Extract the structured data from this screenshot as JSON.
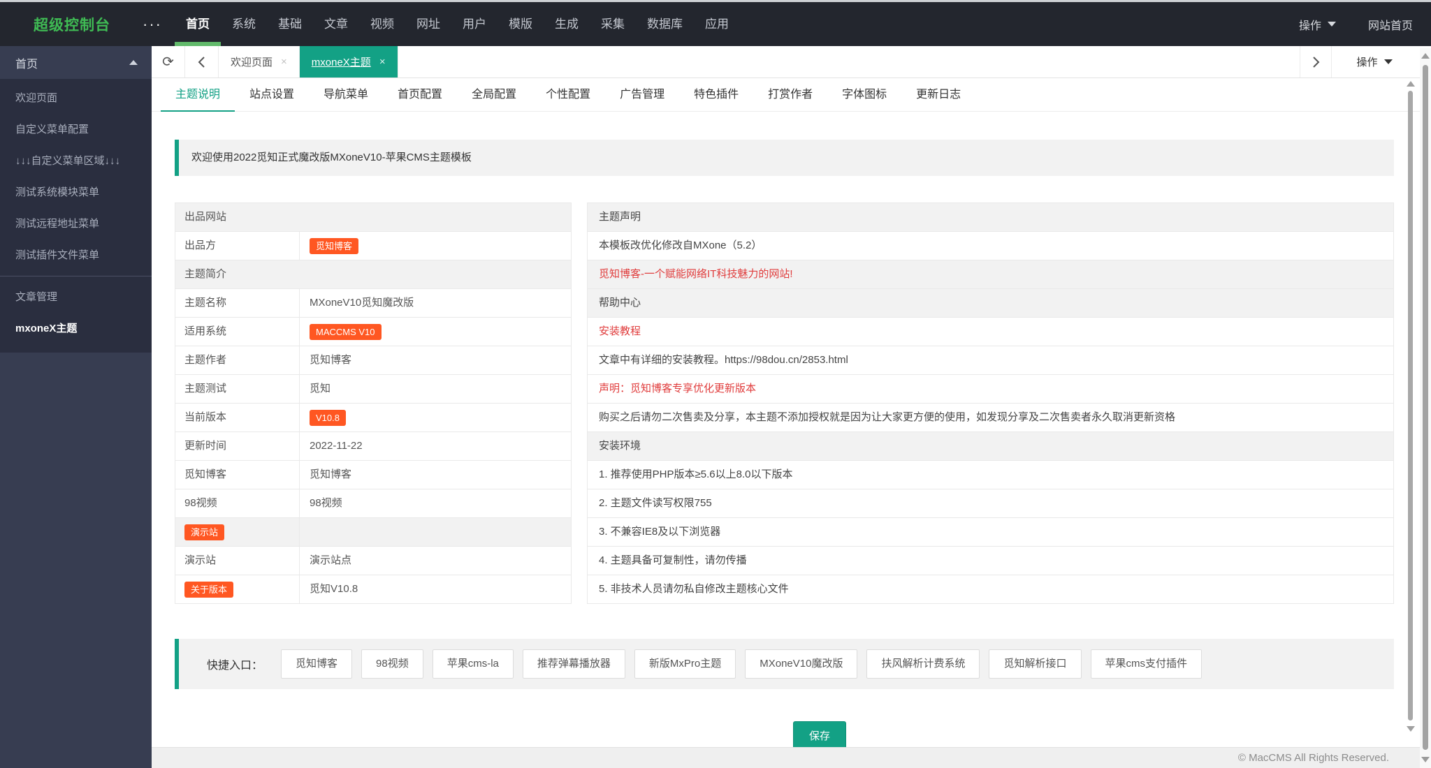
{
  "colors": {
    "accent_teal": "#13a185",
    "brand_green": "#3fbb54",
    "nav_underline_green": "#62ba6b",
    "badge_orange": "#ff5722",
    "red_text": "#e03c3c",
    "topbar_bg": "#23262e",
    "sidebar_bg": "#373d51",
    "sidebar_panel_bg": "#2a2e3f"
  },
  "topbar": {
    "logo": "超级控制台",
    "more_icon": "···",
    "nav": [
      "首页",
      "系统",
      "基础",
      "文章",
      "视频",
      "网址",
      "用户",
      "模版",
      "生成",
      "采集",
      "数据库",
      "应用"
    ],
    "action": "操作",
    "site_home": "网站首页"
  },
  "sidebar": {
    "section": "首页",
    "items": [
      "欢迎页面",
      "自定义菜单配置",
      "↓↓↓自定义菜单区域↓↓↓",
      "测试系统模块菜单",
      "测试远程地址菜单",
      "测试插件文件菜单"
    ],
    "group_label": "文章管理",
    "active_item": "mxoneX主题"
  },
  "tabstrip": {
    "tab1": "欢迎页面",
    "tab2": "mxoneX主题",
    "close": "×",
    "refresh_icon": "⟳",
    "action": "操作"
  },
  "content_tabs": [
    "主题说明",
    "站点设置",
    "导航菜单",
    "首页配置",
    "全局配置",
    "个性配置",
    "广告管理",
    "特色插件",
    "打赏作者",
    "字体图标",
    "更新日志"
  ],
  "banner": "欢迎使用2022觅知正式魔改版MXoneV10-苹果CMS主题模板",
  "theme_info": {
    "rows": [
      {
        "label": "出品网站"
      },
      {
        "label": "出品方",
        "badge": "觅知博客"
      },
      {
        "label": "主题简介"
      },
      {
        "label": "主题名称",
        "value": "MXoneV10觅知魔改版"
      },
      {
        "label": "适用系统",
        "badge": "MACCMS V10"
      },
      {
        "label": "主题作者",
        "value": "觅知博客"
      },
      {
        "label": "主题测试",
        "value": "觅知"
      },
      {
        "label": "当前版本",
        "badge": "V10.8"
      },
      {
        "label": "更新时间",
        "value": "2022-11-22"
      },
      {
        "label": "觅知博客",
        "value": "觅知博客"
      },
      {
        "label": "98视频",
        "value": "98视频"
      },
      {
        "label_badge": "演示站"
      },
      {
        "label": "演示站",
        "value": "演示站点"
      },
      {
        "label_badge": "关于版本",
        "value": "觅知V10.8"
      }
    ]
  },
  "theme_notes": {
    "rows": [
      {
        "text": "主题声明"
      },
      {
        "text": "本模板改优化修改自MXone（5.2）"
      },
      {
        "text": "觅知博客-一个赋能网络IT科技魅力的网站!"
      },
      {
        "text": "帮助中心"
      },
      {
        "text": "安装教程"
      },
      {
        "text": "文章中有详细的安装教程。https://98dou.cn/2853.html"
      },
      {
        "text": "声明：觅知博客专享优化更新版本"
      },
      {
        "text": "购买之后请勿二次售卖及分享，本主题不添加授权就是因为让大家更方便的使用，如发现分享及二次售卖者永久取消更新资格"
      },
      {
        "text": "安装环境"
      },
      {
        "text": "1. 推荐使用PHP版本≥5.6以上8.0以下版本"
      },
      {
        "text": "2. 主题文件读写权限755"
      },
      {
        "text": "3. 不兼容IE8及以下浏览器"
      },
      {
        "text": "4. 主题具备可复制性，请勿传播"
      },
      {
        "text": "5. 非技术人员请勿私自修改主题核心文件"
      }
    ]
  },
  "quick": {
    "label": "快捷入口：",
    "links": [
      "觅知博客",
      "98视频",
      "苹果cms-la",
      "推荐弹幕播放器",
      "新版MxPro主题",
      "MXoneV10魔改版",
      "扶风解析计费系统",
      "觅知解析接口",
      "苹果cms支付插件"
    ]
  },
  "save_button": "保存",
  "footer": "© MacCMS All Rights Reserved."
}
